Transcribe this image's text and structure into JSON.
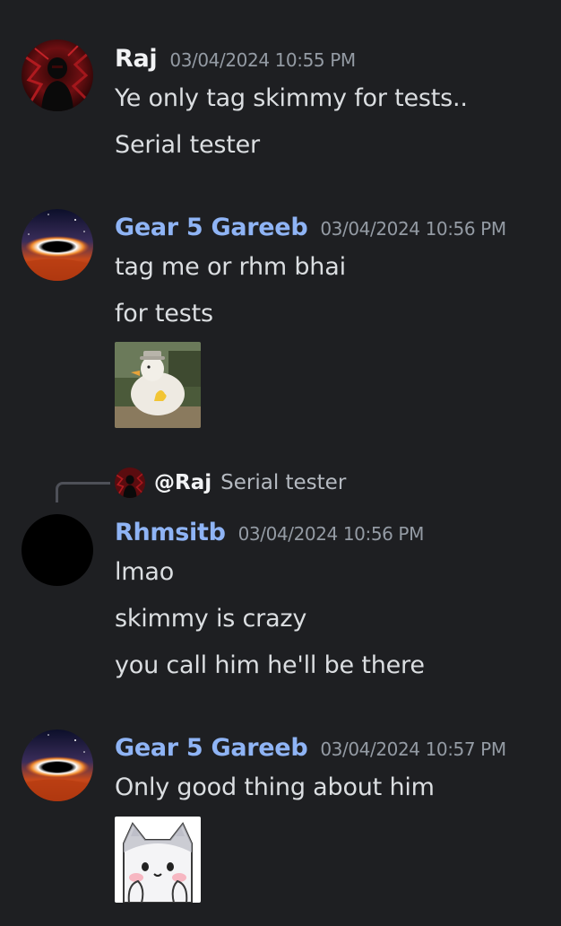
{
  "messages": [
    {
      "author": "Raj",
      "timestamp": "03/04/2024 10:55 PM",
      "lines": [
        "Ye only tag skimmy for tests..",
        "Serial tester"
      ],
      "avatar": "dark-red-silhouette-avatar"
    },
    {
      "author": "Gear 5 Gareeb",
      "timestamp": "03/04/2024 10:56 PM",
      "lines": [
        "tag me or rhm bhai",
        "for tests"
      ],
      "avatar": "galaxy-black-hole-avatar",
      "attachment": "duck-thumbs-up-image"
    },
    {
      "author": "Rhmsitb",
      "timestamp": "03/04/2024 10:56 PM",
      "reply": {
        "author": "@Raj",
        "text": "Serial tester"
      },
      "lines": [
        "lmao",
        "skimmy is crazy",
        "you call him he'll be there"
      ],
      "avatar": "black-circle-avatar"
    },
    {
      "author": "Gear 5 Gareeb",
      "timestamp": "03/04/2024 10:57 PM",
      "lines": [
        "Only good thing about him"
      ],
      "avatar": "galaxy-black-hole-avatar",
      "attachment": "cat-sticker"
    }
  ],
  "colors": {
    "background": "#1e1f22",
    "username_blue": "#8fb4f5",
    "username_white": "#f2f3f5",
    "timestamp": "#949ba4"
  }
}
